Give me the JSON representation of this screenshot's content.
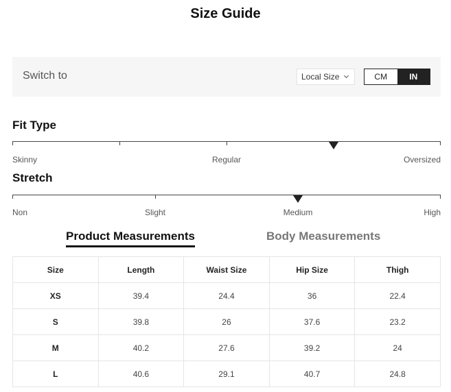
{
  "page": {
    "title": "Size Guide"
  },
  "switch": {
    "label": "Switch to",
    "size_system": "Local Size",
    "units": [
      "CM",
      "IN"
    ],
    "active_unit": "IN"
  },
  "fit_type": {
    "title": "Fit Type",
    "labels": [
      "Skinny",
      "Regular",
      "Oversized"
    ],
    "marker_position": 0.75
  },
  "stretch": {
    "title": "Stretch",
    "labels": [
      "Non",
      "Slight",
      "Medium",
      "High"
    ],
    "marker_position": 0.667
  },
  "tabs": {
    "product": "Product Measurements",
    "body": "Body Measurements",
    "active": "product"
  },
  "table": {
    "headers": [
      "Size",
      "Length",
      "Waist Size",
      "Hip Size",
      "Thigh"
    ],
    "rows": [
      [
        "XS",
        "39.4",
        "24.4",
        "36",
        "22.4"
      ],
      [
        "S",
        "39.8",
        "26",
        "37.6",
        "23.2"
      ],
      [
        "M",
        "40.2",
        "27.6",
        "39.2",
        "24"
      ],
      [
        "L",
        "40.6",
        "29.1",
        "40.7",
        "24.8"
      ]
    ]
  },
  "colors": {
    "accent": "#222222",
    "panel": "#f6f6f6",
    "border": "#e5e5e5"
  }
}
